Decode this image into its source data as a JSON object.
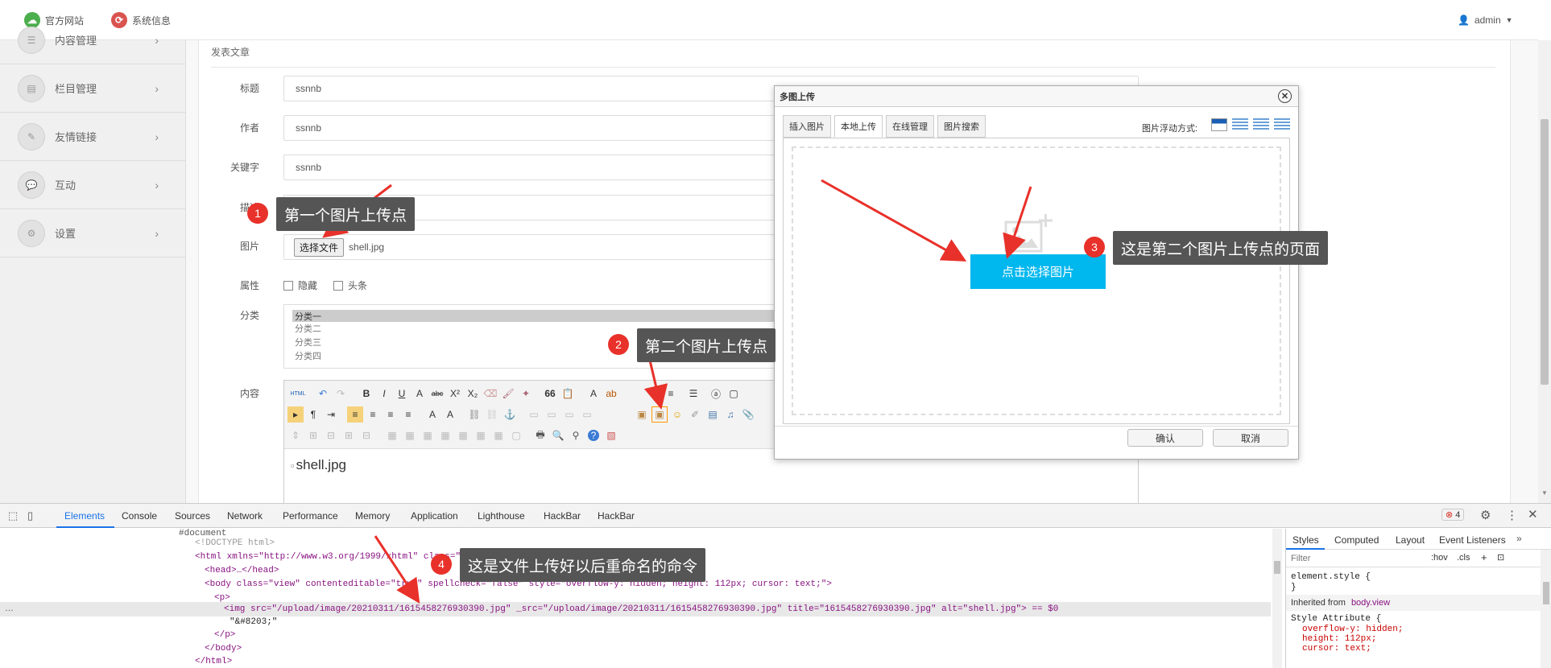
{
  "topbar": {
    "official_site": "官方网站",
    "system_info": "系统信息",
    "user": "admin"
  },
  "sidebar": {
    "items": [
      {
        "label": "内容管理"
      },
      {
        "label": "栏目管理"
      },
      {
        "label": "友情链接"
      },
      {
        "label": "互动"
      },
      {
        "label": "设置"
      }
    ]
  },
  "form": {
    "section_title": "发表文章",
    "title_label": "标题",
    "title_value": "ssnnb",
    "author_label": "作者",
    "author_value": "ssnnb",
    "keywords_label": "关键字",
    "keywords_value": "ssnnb",
    "desc_label": "描述",
    "desc_value": "ssnnb",
    "image_label": "图片",
    "choose_file": "选择文件",
    "file_name": "shell.jpg",
    "attr_label": "属性",
    "attr_hidden": "隐藏",
    "attr_headline": "头条",
    "category_label": "分类",
    "categories": [
      "分类一",
      "分类二",
      "分类三",
      "分类四"
    ],
    "content_label": "内容",
    "broken_image_alt": "shell.jpg"
  },
  "dialog": {
    "title": "多图上传",
    "tabs": [
      "插入图片",
      "本地上传",
      "在线管理",
      "图片搜索"
    ],
    "float_label": "图片浮动方式:",
    "select_button": "点击选择图片",
    "confirm": "确认",
    "cancel": "取消"
  },
  "annotations": {
    "a1": {
      "num": "1",
      "text": "第一个图片上传点"
    },
    "a2": {
      "num": "2",
      "text": "第二个图片上传点"
    },
    "a3": {
      "num": "3",
      "text": "这是第二个图片上传点的页面"
    },
    "a4": {
      "num": "4",
      "text": "这是文件上传好以后重命名的命令"
    }
  },
  "devtools": {
    "tabs": [
      "Elements",
      "Console",
      "Sources",
      "Network",
      "Performance",
      "Memory",
      "Application",
      "Lighthouse",
      "HackBar",
      "HackBar"
    ],
    "error_count": "4",
    "lines": [
      "#document",
      "<!DOCTYPE html>",
      "<html xmlns=\"http://www.w3.org/1999/xhtml\" class=\"view\">",
      "<head>…</head>",
      "<body class=\"view\" contenteditable=\"true\" spellcheck=\"false\" style=\"overflow-y: hidden; height: 112px; cursor: text;\">",
      "<p>",
      "<img src=\"/upload/image/20210311/1615458276930390.jpg\" _src=\"/upload/image/20210311/1615458276930390.jpg\" title=\"1615458276930390.jpg\" alt=\"shell.jpg\"> == $0",
      "\"&#8203;\"",
      "</p>",
      "</body>",
      "</html>"
    ],
    "styles_tabs": [
      "Styles",
      "Computed",
      "Layout",
      "Event Listeners"
    ],
    "filter_placeholder": "Filter",
    "hov": ":hov",
    "cls": ".cls",
    "element_style": "element.style {",
    "close_brace": "}",
    "inherited_from": "Inherited from",
    "inherited_target": "body.view",
    "style_attribute": "Style Attribute {",
    "style_props": [
      "overflow-y: hidden;",
      "height: 112px;",
      "cursor: text;"
    ]
  }
}
